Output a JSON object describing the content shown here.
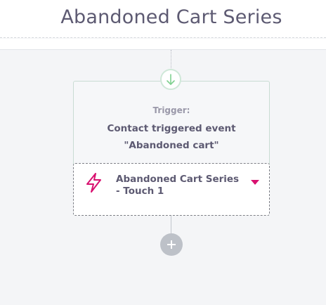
{
  "header": {
    "title": "Abandoned Cart Series"
  },
  "trigger_card": {
    "label": "Trigger:",
    "line1": "Contact triggered event",
    "line2": "\"Abandoned cart\""
  },
  "action_step": {
    "line1": "Abandoned Cart Series",
    "line2": "- Touch 1",
    "icon": "lightning-icon"
  },
  "colors": {
    "accent": "#d8106f",
    "trigger_green": "#7fd08f",
    "text": "#5d5a72"
  }
}
